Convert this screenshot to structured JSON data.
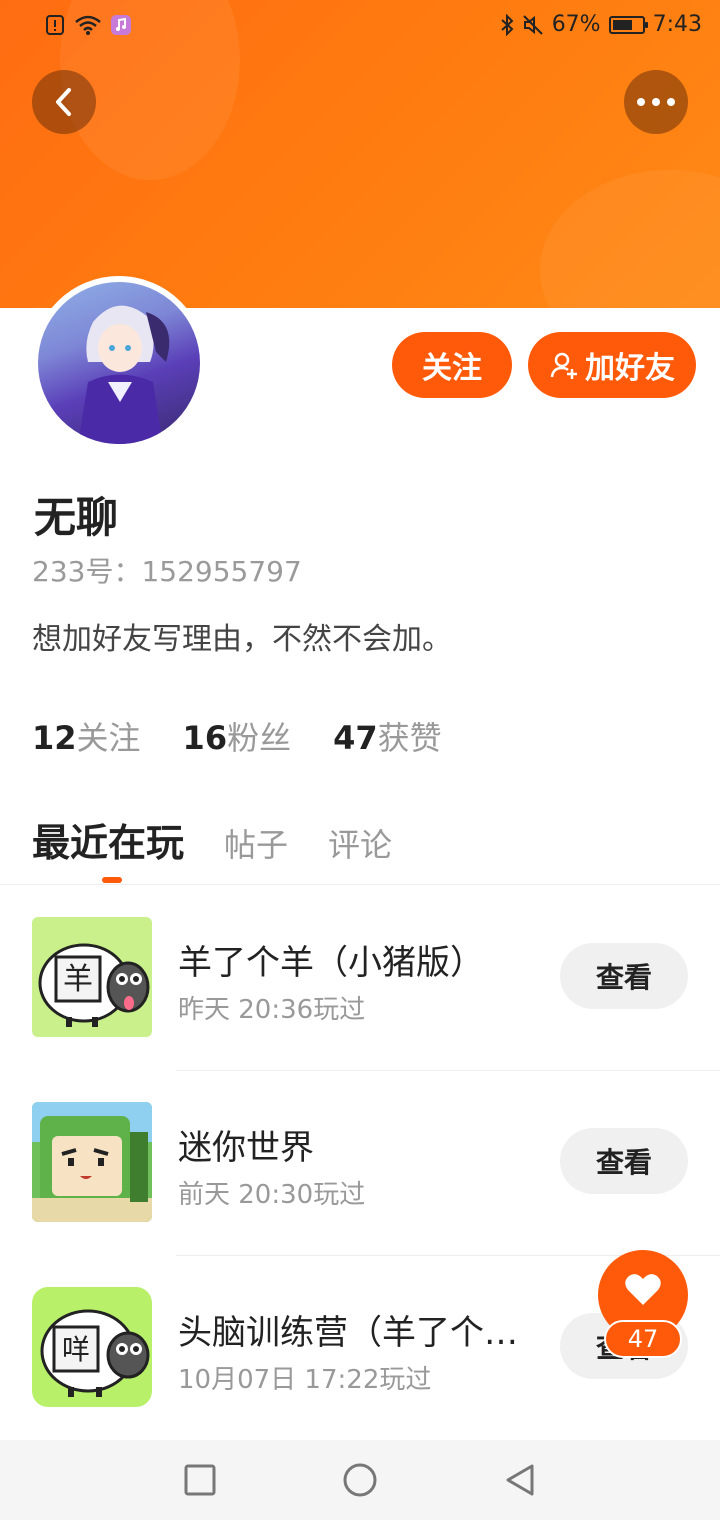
{
  "status_bar": {
    "battery": "67%",
    "battery_level": 0.67,
    "time": "7:43",
    "icons": [
      "alert-icon",
      "wifi-icon",
      "music-app-icon",
      "bluetooth-icon",
      "mute-icon",
      "battery-icon"
    ]
  },
  "colors": {
    "accent": "#ff5a0a",
    "banner": "#ff7a10",
    "muted_text": "#999999",
    "button_bg": "#f0f0f0"
  },
  "profile": {
    "name": "无聊",
    "uid": "233号：152955797",
    "bio": "想加好友写理由，不然不会加。",
    "follow_label": "关注",
    "add_friend_label": "加好友"
  },
  "stats": [
    {
      "value": "12",
      "label": "关注"
    },
    {
      "value": "16",
      "label": "粉丝"
    },
    {
      "value": "47",
      "label": "获赞"
    }
  ],
  "tabs": [
    {
      "label": "最近在玩",
      "active": true
    },
    {
      "label": "帖子",
      "active": false
    },
    {
      "label": "评论",
      "active": false
    }
  ],
  "games": [
    {
      "title": "羊了个羊（小猪版）",
      "played": "昨天 20:36玩过",
      "button": "查看",
      "icon_glyph": "羊"
    },
    {
      "title": "迷你世界",
      "played": "前天 20:30玩过",
      "button": "查看",
      "icon_glyph": ""
    },
    {
      "title": "头脑训练营（羊了个…",
      "played": "10月07日 17:22玩过",
      "button": "查看",
      "icon_glyph": "咩"
    }
  ],
  "like_fab": {
    "count": "47"
  }
}
